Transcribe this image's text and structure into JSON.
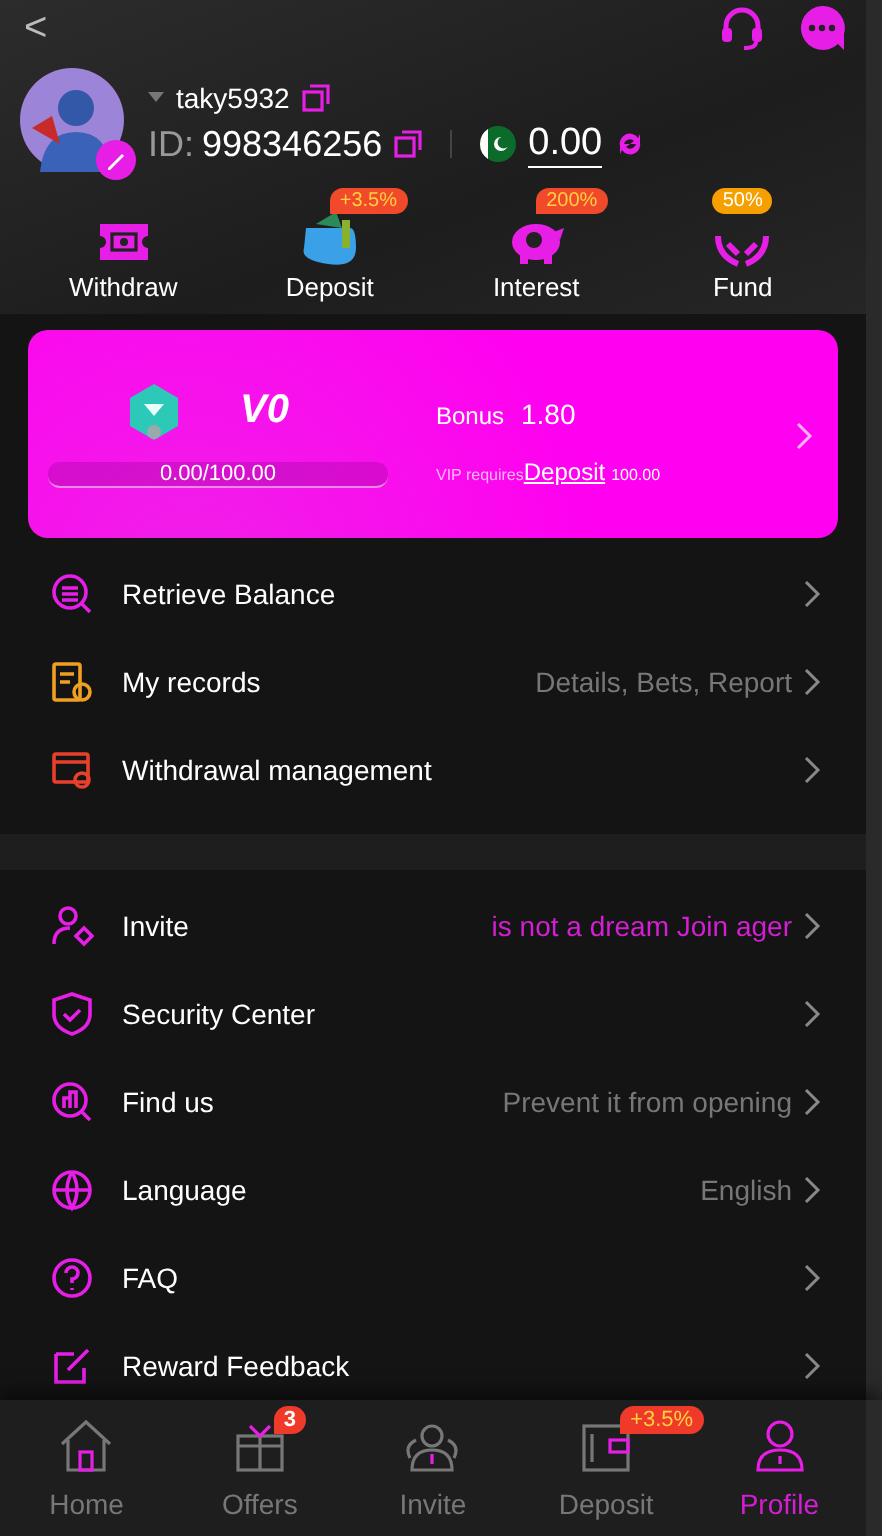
{
  "header": {
    "back": "<"
  },
  "profile": {
    "username": "taky5932",
    "id_label": "ID:",
    "id": "998346256",
    "balance": "0.00"
  },
  "actions": [
    {
      "label": "Withdraw"
    },
    {
      "label": "Deposit",
      "badge": "+3.5%",
      "color": "#f04a2a"
    },
    {
      "label": "Interest",
      "badge": "200%",
      "color": "#f04a2a"
    },
    {
      "label": "Fund",
      "badge": "50%",
      "color": "#f5a000"
    }
  ],
  "vip": {
    "level_name": "V0",
    "progress": "0.00/100.00",
    "level": 0,
    "bonus_label": "Bonus",
    "bonus": "1.80",
    "requires": "VIP requires",
    "link": "Deposit",
    "amount": "100.00"
  },
  "menu_groups": [
    [
      {
        "label": "Retrieve Balance"
      },
      {
        "label": "My records",
        "value": "Details, Bets, Report",
        "kind": "hint"
      },
      {
        "label": "Withdrawal management"
      }
    ],
    [
      {
        "label": "Invite",
        "value": "is not a dream  Join ager",
        "kind": "promo"
      },
      {
        "label": "Security Center"
      },
      {
        "label": "Find us",
        "value": "Prevent it from opening",
        "kind": "hint"
      },
      {
        "label": "Language",
        "value": "English",
        "kind": "hint"
      },
      {
        "label": "FAQ"
      },
      {
        "label": "Reward Feedback"
      }
    ]
  ],
  "tabs": [
    {
      "label": "Home",
      "selected": false
    },
    {
      "label": "Offers",
      "selected": false,
      "badge": "3"
    },
    {
      "label": "Invite",
      "selected": false
    },
    {
      "label": "Deposit",
      "selected": false,
      "badge": "+3.5%"
    },
    {
      "label": "Profile",
      "selected": true
    }
  ]
}
